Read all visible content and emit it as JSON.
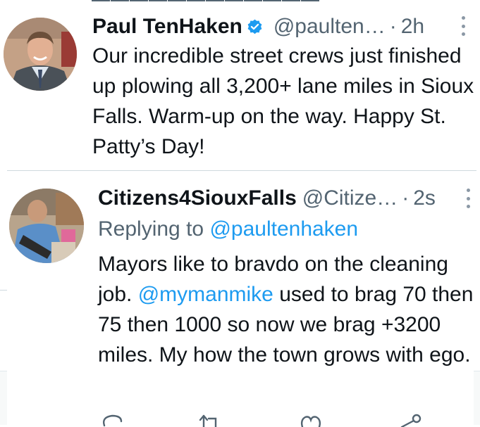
{
  "tweet1": {
    "author_name": "Paul TenHaken",
    "handle": "@paulten…",
    "separator": "·",
    "time": "2h",
    "text": "Our incredible street crews just finished up plowing all 3,200+ lane miles in Sioux Falls. Warm-up on the way. Happy St. Patty’s Day!"
  },
  "tweet2": {
    "author_name": "Citizens4SiouxFalls",
    "handle": "@Citize…",
    "separator": "·",
    "time": "2s",
    "replying_prefix": "Replying to ",
    "replying_handle": "@paultenhaken",
    "text_before_mention": "Mayors like to bravdo on the cleaning job. ",
    "mention": "@mymanmike",
    "text_after_mention": " used to brag 70 then 75 then 1000 so now we brag +3200 miles. My how the town grows with ego."
  },
  "colors": {
    "link": "#1d9bf0",
    "secondary_text": "#536471",
    "verified_badge": "#1d9bf0",
    "divider": "#cfd9de"
  },
  "icons": [
    "verified-badge-icon",
    "more-options-icon",
    "reply-icon",
    "retweet-icon",
    "like-icon",
    "share-icon"
  ]
}
